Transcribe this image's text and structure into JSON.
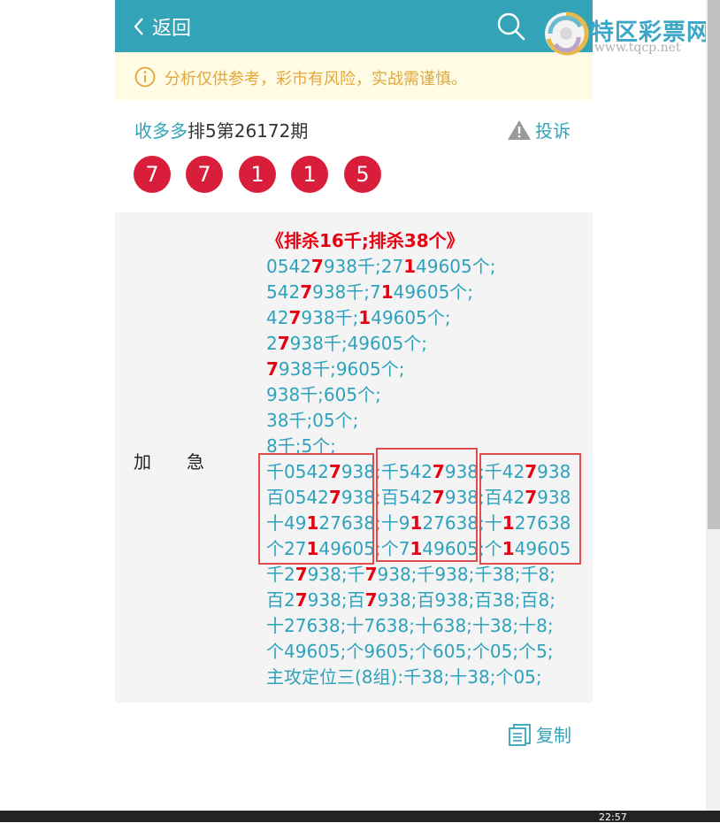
{
  "header": {
    "back_label": "返回"
  },
  "logo": {
    "name": "特区彩票网",
    "url": "www.tqcp.net"
  },
  "notice": {
    "text": "分析仅供参考，彩市有风险，实战需谨慎。"
  },
  "title": {
    "source": "收多多",
    "rest": "排5第26172期"
  },
  "complain_label": "投诉",
  "balls": [
    "7",
    "7",
    "1",
    "1",
    "5"
  ],
  "content": {
    "label": "加急",
    "lines": [
      [
        [
          "《排杀16千;排杀38个》",
          "head"
        ]
      ],
      [
        [
          "0542",
          ""
        ],
        [
          "7",
          "hl"
        ],
        [
          "938千;27",
          ""
        ],
        [
          "1",
          "hl"
        ],
        [
          "49605个;",
          ""
        ]
      ],
      [
        [
          "542",
          ""
        ],
        [
          "7",
          "hl"
        ],
        [
          "938千;7",
          ""
        ],
        [
          "1",
          "hl"
        ],
        [
          "49605个;",
          ""
        ]
      ],
      [
        [
          "42",
          ""
        ],
        [
          "7",
          "hl"
        ],
        [
          "938千;",
          ""
        ],
        [
          "1",
          "hl"
        ],
        [
          "49605个;",
          ""
        ]
      ],
      [
        [
          "2",
          ""
        ],
        [
          "7",
          "hl"
        ],
        [
          "938千;49605个;",
          ""
        ]
      ],
      [
        [
          "7",
          "hl"
        ],
        [
          "938千;9605个;",
          ""
        ]
      ],
      [
        [
          "938千;605个;",
          ""
        ]
      ],
      [
        [
          "38千;05个;",
          ""
        ]
      ],
      [
        [
          "8千;5个;",
          ""
        ]
      ],
      [
        [
          "千0542",
          ""
        ],
        [
          "7",
          "hl"
        ],
        [
          "938;千542",
          ""
        ],
        [
          "7",
          "hl"
        ],
        [
          "938;千42",
          ""
        ],
        [
          "7",
          "hl"
        ],
        [
          "938",
          ""
        ]
      ],
      [
        [
          "百0542",
          ""
        ],
        [
          "7",
          "hl"
        ],
        [
          "938;百542",
          ""
        ],
        [
          "7",
          "hl"
        ],
        [
          "938;百42",
          ""
        ],
        [
          "7",
          "hl"
        ],
        [
          "938",
          ""
        ]
      ],
      [
        [
          "十49",
          ""
        ],
        [
          "1",
          "hl"
        ],
        [
          "27638;十9",
          ""
        ],
        [
          "1",
          "hl"
        ],
        [
          "27638;十",
          ""
        ],
        [
          "1",
          "hl"
        ],
        [
          "27638",
          ""
        ]
      ],
      [
        [
          "个27",
          ""
        ],
        [
          "1",
          "hl"
        ],
        [
          "49605;个7",
          ""
        ],
        [
          "1",
          "hl"
        ],
        [
          "49605;个",
          ""
        ],
        [
          "1",
          "hl"
        ],
        [
          "49605",
          ""
        ]
      ],
      [
        [
          "千2",
          ""
        ],
        [
          "7",
          "hl"
        ],
        [
          "938;千",
          ""
        ],
        [
          "7",
          "hl"
        ],
        [
          "938;千938;千38;千8;",
          ""
        ]
      ],
      [
        [
          "百2",
          ""
        ],
        [
          "7",
          "hl"
        ],
        [
          "938;百",
          ""
        ],
        [
          "7",
          "hl"
        ],
        [
          "938;百938;百38;百8;",
          ""
        ]
      ],
      [
        [
          "十27638;十7638;十638;十38;十8;",
          ""
        ]
      ],
      [
        [
          "个49605;个9605;个605;个05;个5;",
          ""
        ]
      ],
      [
        [
          "主攻定位三(8组):千38;十38;个05;",
          ""
        ]
      ]
    ]
  },
  "copy_label": "复制",
  "taskbar": {
    "clock": "22:57"
  },
  "colors": {
    "header": "#33a3b8",
    "ball": "#d81e3a",
    "highlight": "#e60012",
    "text_blue": "#2ea2bd",
    "notice_text": "#e2a83a"
  }
}
